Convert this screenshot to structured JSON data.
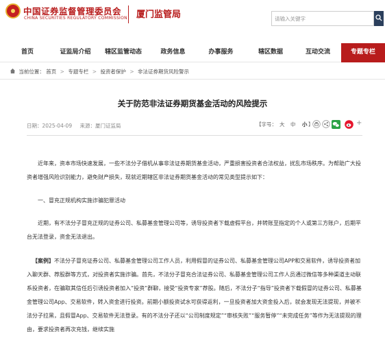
{
  "header": {
    "org_name_cn": "中国证券监督管理委员会",
    "org_name_en": "CHINA SECURITIES REGULATORY COMMISSION",
    "bureau_name": "厦门监管局",
    "search_placeholder": "请输入关键字"
  },
  "nav": {
    "items": [
      {
        "label": "首页"
      },
      {
        "label": "证监局介绍"
      },
      {
        "label": "辖区监管动态"
      },
      {
        "label": "政务信息"
      },
      {
        "label": "办事服务"
      },
      {
        "label": "辖区数据"
      },
      {
        "label": "互动交流"
      },
      {
        "label": "专题专栏"
      }
    ],
    "active_index": 7,
    "active_color": "#b81c1c"
  },
  "breadcrumb": {
    "prefix": "当前位置：",
    "items": [
      "首页",
      "专题专栏",
      "投资者保护",
      "非法证券期货风险警示"
    ],
    "separator": ">"
  },
  "article": {
    "title": "关于防范非法证券期货基金活动的风险提示",
    "date_label": "日期：2025-04-09",
    "source_label": "来源：厦门证监局",
    "font_size_label": "【字号：",
    "font_large": "大",
    "font_medium": "中",
    "font_small": "小",
    "font_close": "】",
    "paragraphs": [
      "近年来，资本市场快速发展，一些不法分子借机从事非法证券期货基金活动，严重损害投资者合法权益，扰乱市场秩序。为帮助广大投资者增强风险识别能力，避免财产损失，现就近期辖区非法证券期货基金活动的常见类型提示如下：",
      "一、冒充正规机构实施诈骗犯罪活动",
      "近期，有不法分子冒充正规的证券公司、私募基金管理公司等，诱导投资者下载虚假平台，并转账至指定的个人或第三方账户，后期平台无法登录，资金无法退出。",
      "不法分子冒充证券公司、私募基金管理公司工作人员，利用假冒的证券公司、私募基金管理公司APP和交易软件，诱导投资者加入聊天群、荐股群等方式，对投资者实施诈骗。首先，不法分子冒充合法证券公司、私募基金管理公司工作人员通过微信等多种渠道主动联系投资者，在骗取其信任后引诱投资者加入“投资”群聊，接受“投资专家”荐股。随后，不法分子“指导”投资者下载假冒的证券公司、私募基金管理公司App、交易软件，转入资金进行投资。前期小额投资试水可获得返利，一旦投资者加大资金投入后，就会发现无法提现，并被不法分子拉黑，且假冒App、交易软件无法登录。有的不法分子还以“公司制度规定”“审核失败”“服务暂停”“未完成任务”等作为无法提现的理由，要求投资者再次充钱，继续实施"
    ],
    "case_label": "【案例】"
  }
}
